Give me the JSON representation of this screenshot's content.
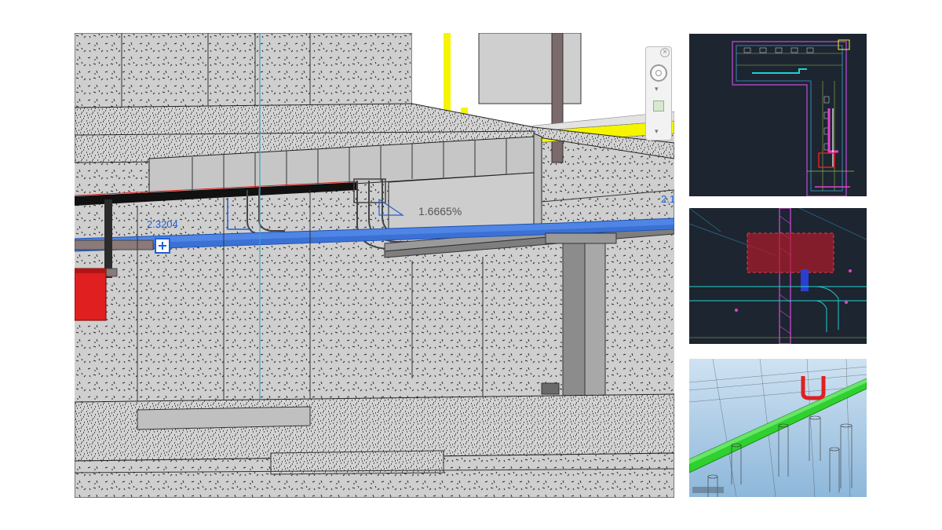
{
  "main_view": {
    "dimension_left": "2.3204",
    "slope_label": "1.6665%",
    "dimension_right": "2.1",
    "colors": {
      "concrete": "#cfcfcf",
      "pipe_blue": "#3b82f6",
      "duct_black": "#111111",
      "equipment_red": "#e02020",
      "highlight_yellow": "#f5f500",
      "column_gray": "#8c8c8c"
    }
  },
  "nav_widget": {
    "icons": [
      "close-icon",
      "steering-wheel-icon",
      "chevron-down-icon",
      "zoom-icon",
      "more-icon"
    ]
  },
  "thumbnails": [
    {
      "name": "plan-view-overview",
      "background": "#1d2530"
    },
    {
      "name": "plan-view-detail",
      "background": "#1d2530"
    },
    {
      "name": "3d-clash-view",
      "background": "#9fc3e0"
    }
  ]
}
